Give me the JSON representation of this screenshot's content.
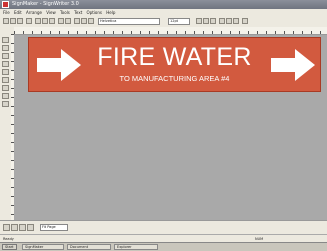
{
  "window": {
    "title": "SignMaker - SignWriter 3.0"
  },
  "menu": [
    "File",
    "Edit",
    "Arrange",
    "View",
    "Tools",
    "Text",
    "Options",
    "Help"
  ],
  "toolbar": {
    "font_field": "Helvetica",
    "size_field": "12pt"
  },
  "sign": {
    "title": "FIRE WATER",
    "subtitle": "TO MANUFACTURING AREA #4",
    "background_color": "#d25a3f",
    "text_color": "#ffffff",
    "arrows": [
      "arrow-right-icon",
      "arrow-right-icon"
    ]
  },
  "bottombar": {
    "zoom_field": "Fit Page"
  },
  "status": {
    "left": "Ready",
    "right": "NUM"
  },
  "taskbar": {
    "start": "Start",
    "tasks": [
      "SignMaker",
      "Document",
      "Explorer"
    ]
  }
}
